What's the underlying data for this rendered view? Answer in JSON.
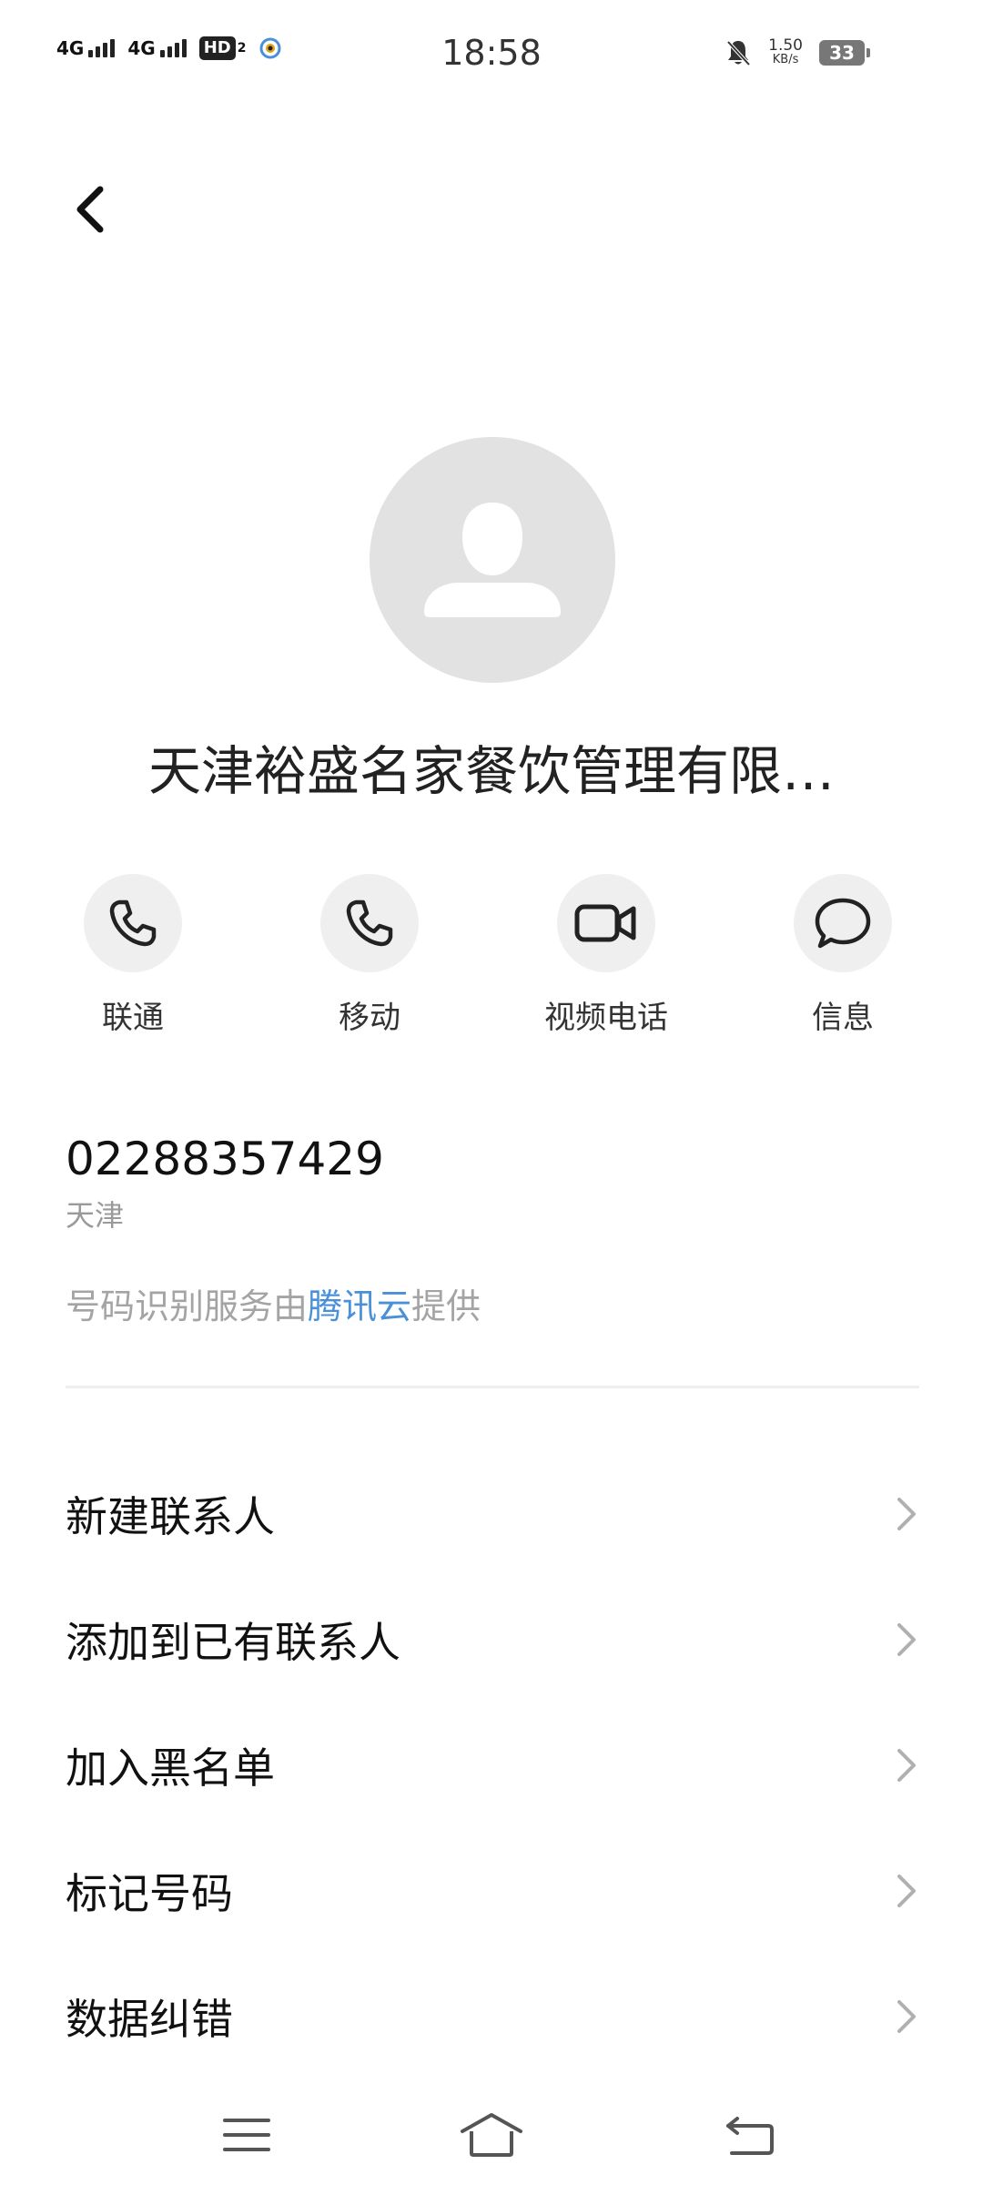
{
  "status_bar": {
    "signal1_label": "4G",
    "signal2_label": "4G",
    "hd_label": "HD",
    "hd_sub": "2",
    "time": "18:58",
    "net_speed_value": "1.50",
    "net_speed_unit": "KB/s",
    "battery": "33"
  },
  "contact": {
    "name": "天津裕盛名家餐饮管理有限…",
    "number": "02288357429",
    "location": "天津"
  },
  "actions": [
    {
      "label": "联通",
      "icon": "phone-icon"
    },
    {
      "label": "移动",
      "icon": "phone-icon"
    },
    {
      "label": "视频电话",
      "icon": "video-icon"
    },
    {
      "label": "信息",
      "icon": "message-icon"
    }
  ],
  "provider": {
    "prefix": "号码识别服务由",
    "link": "腾讯云",
    "suffix": "提供"
  },
  "menu": [
    {
      "label": "新建联系人"
    },
    {
      "label": "添加到已有联系人"
    },
    {
      "label": "加入黑名单"
    },
    {
      "label": "标记号码"
    },
    {
      "label": "数据纠错"
    }
  ],
  "colors": {
    "link": "#4a90d9",
    "avatar_bg": "#e2e2e2",
    "action_bg": "#efefef"
  }
}
